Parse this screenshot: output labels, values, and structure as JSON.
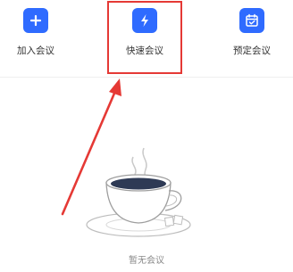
{
  "toolbar": {
    "join": {
      "label": "加入会议",
      "icon": "plus-icon"
    },
    "quick": {
      "label": "快速会议",
      "icon": "lightning-icon"
    },
    "schedule": {
      "label": "预定会议",
      "icon": "calendar-check-icon"
    }
  },
  "highlight": {
    "color": "#e53935"
  },
  "accent": "#2f6bff",
  "empty_state": {
    "text": "暂无会议",
    "illustration": "coffee-cup-illustration"
  }
}
